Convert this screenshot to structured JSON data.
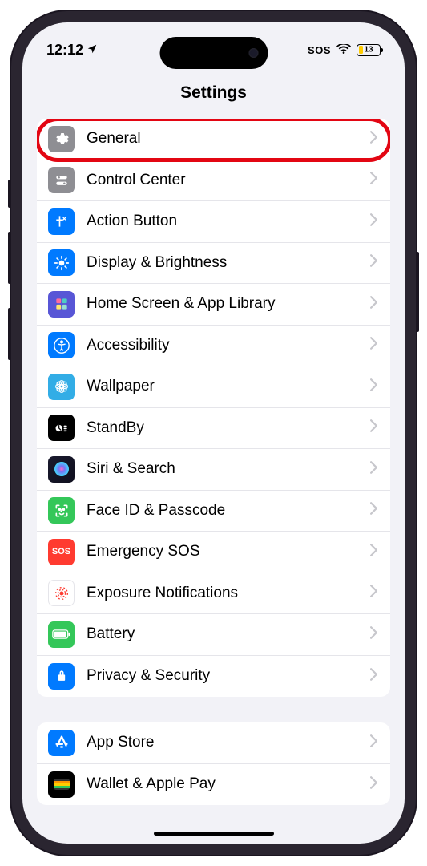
{
  "statusBar": {
    "time": "12:12",
    "sos": "SOS",
    "battery": "13"
  },
  "header": {
    "title": "Settings"
  },
  "group1": [
    {
      "id": "general",
      "label": "General",
      "iconBg": "bg-gray",
      "highlighted": true
    },
    {
      "id": "control-center",
      "label": "Control Center",
      "iconBg": "bg-gray"
    },
    {
      "id": "action-button",
      "label": "Action Button",
      "iconBg": "bg-blue"
    },
    {
      "id": "display",
      "label": "Display & Brightness",
      "iconBg": "bg-blue"
    },
    {
      "id": "home-screen",
      "label": "Home Screen & App Library",
      "iconBg": "bg-purple"
    },
    {
      "id": "accessibility",
      "label": "Accessibility",
      "iconBg": "bg-blue"
    },
    {
      "id": "wallpaper",
      "label": "Wallpaper",
      "iconBg": "bg-cyan"
    },
    {
      "id": "standby",
      "label": "StandBy",
      "iconBg": "bg-black"
    },
    {
      "id": "siri",
      "label": "Siri & Search",
      "iconBg": "bg-siri"
    },
    {
      "id": "faceid",
      "label": "Face ID & Passcode",
      "iconBg": "bg-green"
    },
    {
      "id": "sos",
      "label": "Emergency SOS",
      "iconBg": "bg-red"
    },
    {
      "id": "exposure",
      "label": "Exposure Notifications",
      "iconBg": "bg-white-border"
    },
    {
      "id": "battery",
      "label": "Battery",
      "iconBg": "bg-green"
    },
    {
      "id": "privacy",
      "label": "Privacy & Security",
      "iconBg": "bg-blue"
    }
  ],
  "group2": [
    {
      "id": "appstore",
      "label": "App Store",
      "iconBg": "bg-blue"
    },
    {
      "id": "wallet",
      "label": "Wallet & Apple Pay",
      "iconBg": "bg-black"
    }
  ]
}
